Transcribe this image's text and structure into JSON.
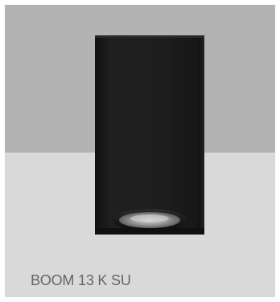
{
  "product": {
    "name": "BOOM 13 K SU",
    "image_icon": "surface-mounted-square-downlight",
    "body_color": "#1b1b1b",
    "background_top_color": "#b3b3b3",
    "background_bottom_color": "#d9d9d9"
  }
}
